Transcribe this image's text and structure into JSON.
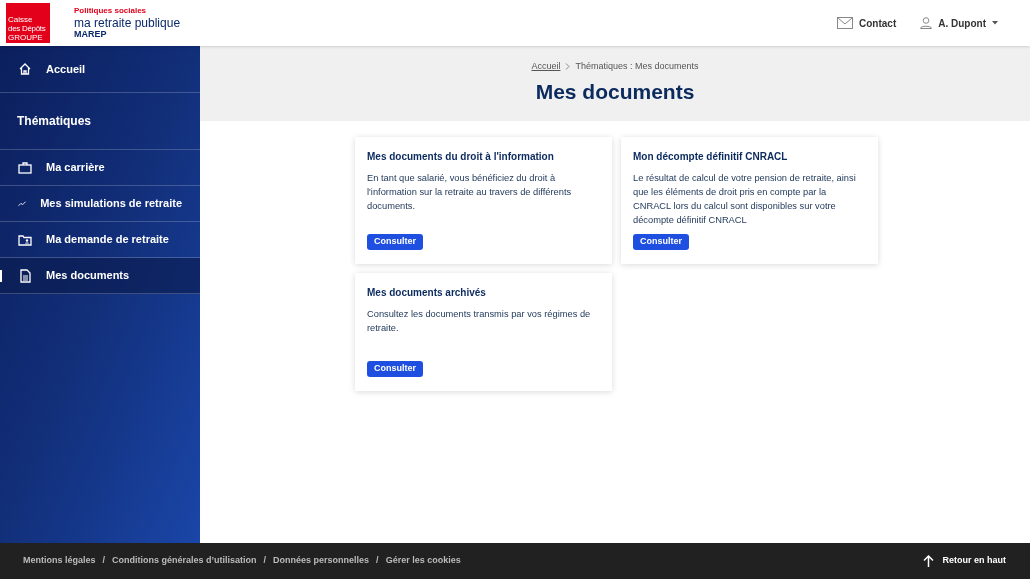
{
  "header": {
    "logo": {
      "line_1": "Caisse",
      "line_2": "des Dépôts",
      "line_3": "GROUPE"
    },
    "brand": {
      "tagline": "Politiques sociales",
      "name": "ma retraite publique",
      "acronym": "MAREP"
    },
    "contact": "Contact",
    "user": "A. Dupont"
  },
  "sidebar": {
    "home": {
      "label": "Accueil",
      "kind": "home",
      "selected": false
    },
    "section_title": "Thématiques",
    "items": [
      {
        "label": "Ma carrière",
        "kind": "briefcase",
        "selected": false
      },
      {
        "label": "Mes simulations de retraite",
        "kind": "trend",
        "selected": false
      },
      {
        "label": "Ma demande de retraite",
        "kind": "folder",
        "selected": false
      },
      {
        "label": "Mes documents",
        "kind": "document",
        "selected": true
      }
    ]
  },
  "breadcrumb": [
    {
      "label": "Accueil",
      "kind": "link"
    },
    {
      "label": "Thématiques : Mes documents",
      "kind": "current"
    }
  ],
  "page_title": "Mes documents",
  "cards": [
    {
      "title": "Mes documents du droit à l'information",
      "text": "En tant que salarié, vous bénéficiez du droit à l'information sur la retraite au travers de différents documents.",
      "button": "Consulter"
    },
    {
      "title": "Mon décompte définitif CNRACL",
      "text": "Le résultat de calcul de votre pension de retraite, ainsi que les éléments de droit pris en compte par la CNRACL lors du calcul sont disponibles sur votre décompte définitif CNRACL",
      "button": "Consulter"
    },
    {
      "title": "Mes documents archivés",
      "text": "Consultez les documents transmis par vos régimes de retraite.",
      "button": "Consulter"
    }
  ],
  "footer": {
    "links": [
      "Mentions légales",
      "Conditions générales d’utilisation",
      "Données personnelles",
      "Gérer les cookies"
    ],
    "separator": "/",
    "back_to_top": "Retour en haut"
  }
}
